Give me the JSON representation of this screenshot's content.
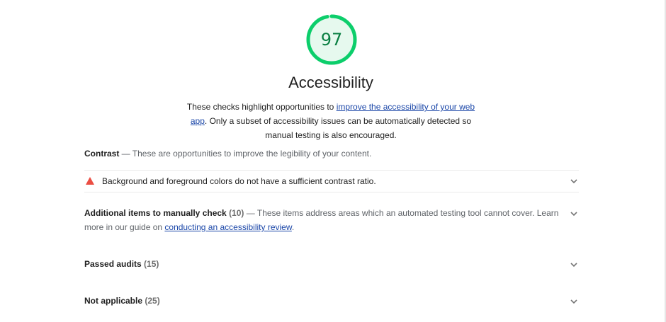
{
  "score": {
    "value": 97,
    "label": "97",
    "color": "#0cce6b",
    "fill": "#e6f9ee",
    "text_color": "#0b8043"
  },
  "category": {
    "title": "Accessibility",
    "desc_before": "These checks highlight opportunities to ",
    "desc_link": "improve the accessibility of your web app",
    "desc_after": ". Only a subset of accessibility issues can be automatically detected so manual testing is also encouraged."
  },
  "contrast_group": {
    "title": "Contrast",
    "separator": " — ",
    "description": "These are opportunities to improve the legibility of your content."
  },
  "contrast_audit": {
    "text": "Background and foreground colors do not have a sufficient contrast ratio.",
    "icon": "warning-triangle-icon",
    "icon_color": "#eb4e43"
  },
  "manual_group": {
    "title": "Additional items to manually check",
    "count": "(10)",
    "separator": " — ",
    "description": "These items address areas which an automated testing tool cannot cover. Learn more in our guide on ",
    "link": "conducting an accessibility review",
    "after_link": "."
  },
  "passed_group": {
    "title": "Passed audits",
    "count": "(15)"
  },
  "not_applicable_group": {
    "title": "Not applicable",
    "count": "(25)"
  },
  "colors": {
    "link": "#1a46a8",
    "chevron": "#757575",
    "divider": "#ebebeb"
  }
}
